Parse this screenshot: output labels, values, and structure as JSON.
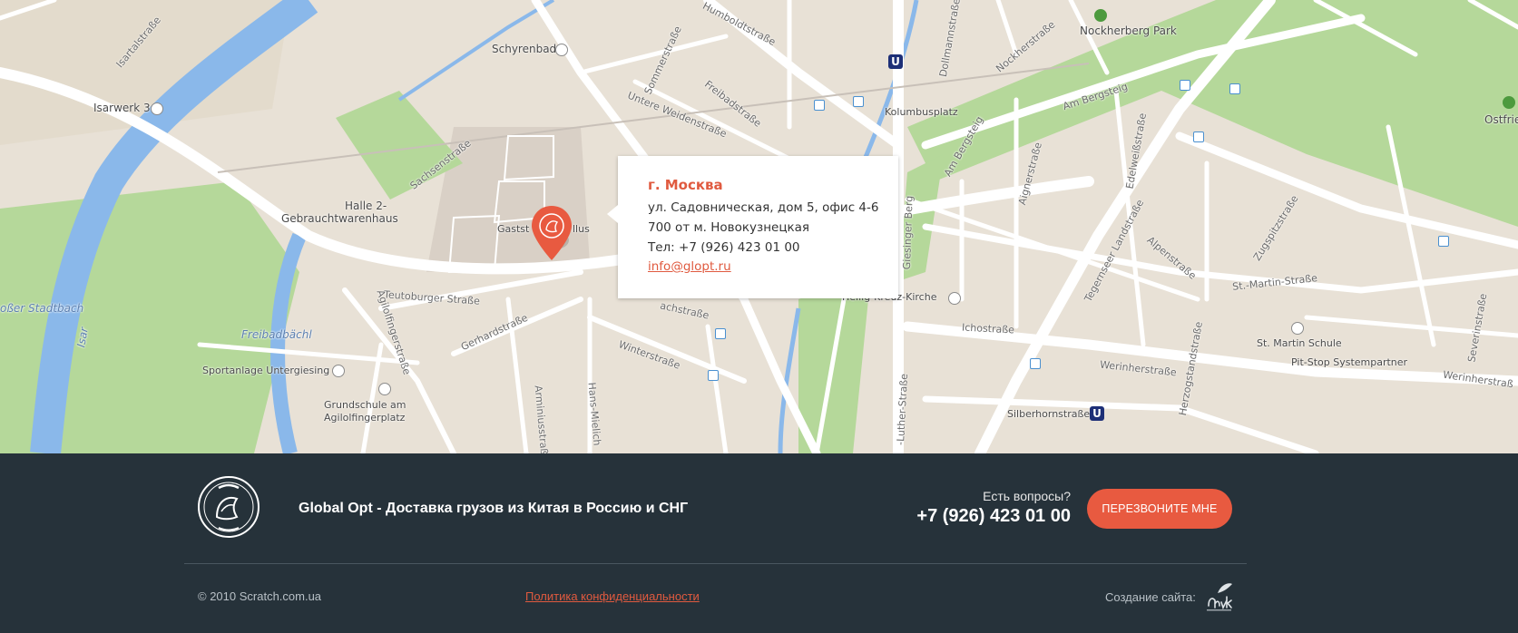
{
  "map": {
    "labels": {
      "schyrenbad": "Schyrenbad",
      "humboldtstrasse": "Humboldtstraße",
      "nockherberg_park": "Nockherberg Park",
      "isartalstrasse": "Isartalstraße",
      "isarwerk": "Isarwerk 3",
      "untere_weidenstrasse": "Untere Weidenstraße",
      "freibadstrasse": "Freibadstraße",
      "kolumbusplatz": "Kolumbusplatz",
      "am_bergsteig": "Am Bergsteig",
      "ostfriedhof": "Ostfried",
      "sachsenstrasse": "Sachsenstraße",
      "halle2_line1": "Halle 2-",
      "halle2_line2": "Gebrauchtwarenhaus",
      "gaststaette": "Gastst",
      "gaststaette_end": "llus",
      "teutoburger": "Teutoburger Straße",
      "heilig_kreuz": "Heilig-Kreuz-Kirche",
      "ichostrasse": "Ichostraße",
      "st_martin_strasse": "St.-Martin-Straße",
      "st_martin_schule": "St. Martin Schule",
      "pit_stop": "Pit-Stop Systempartner",
      "werinherstrasse": "Werinherstraße",
      "werinherstrasse2": "Werinherstraß",
      "silberhornstrasse": "Silberhornstraße",
      "auer_stadtbach": "oßer Stadtbach",
      "freibadbaechl": "Freibadbächl",
      "isar": "Isar",
      "sportanlage": "Sportanlage Untergiesing",
      "grundschule_line1": "Grundschule am",
      "grundschule_line2": "Agilolfingerplatz",
      "gerhardstrasse": "Gerhardstraße",
      "winterstrasse": "Winterstraße",
      "giesinger_berg": "Giesinger Berg",
      "tegernseer": "Tegernseer Landstraße",
      "alpenstrasse": "Alpenstraße",
      "zugspitzstrasse": "Zugspitzstraße",
      "severinstrasse": "Severinstraße",
      "edelweissstrasse": "Edelweißstraße",
      "aignerstrasse": "Aignerstraße",
      "am_bergsteig2": "Am Bergsteig",
      "sommerstrasse": "Sommerstraße",
      "dollmannstrasse": "Dollmannstraße",
      "nockherstrasse": "Nockherstraße",
      "herzogstandstrasse": "Herzogstandstraße",
      "agilolfingerstrasse": "Agilolfingerstraße",
      "hans_mielich": "Hans-Mielich",
      "luther_strasse": "-Luther-Straße",
      "arminiusstrasse": "Arminiusstraße",
      "sachstrasse": "achstraße",
      "u_label": "U"
    },
    "info": {
      "city": "г. Москва",
      "address": "ул. Садовническая, дом 5, офис 4-6",
      "metro": "700 от м. Новокузнецкая",
      "phone": "Тел: +7 (926) 423 01 00",
      "email": "info@glopt.ru"
    }
  },
  "footer": {
    "tagline": "Global Opt - Доставка грузов из Китая в Россию и СНГ",
    "questions": "Есть вопросы?",
    "phone": "+7 (926) 423 01 00",
    "callback_button": "ПЕРЕЗВОНИТЕ МНЕ",
    "copyright": "© 2010 Scratch.com.ua",
    "policy_link": "Политика конфиденциальности",
    "made_by": "Создание сайта:"
  },
  "colors": {
    "accent": "#e85a40",
    "footer_bg": "#26323a",
    "map_land": "#e8e1d6",
    "map_park": "#a9d38c",
    "map_water": "#7fb3e8"
  }
}
